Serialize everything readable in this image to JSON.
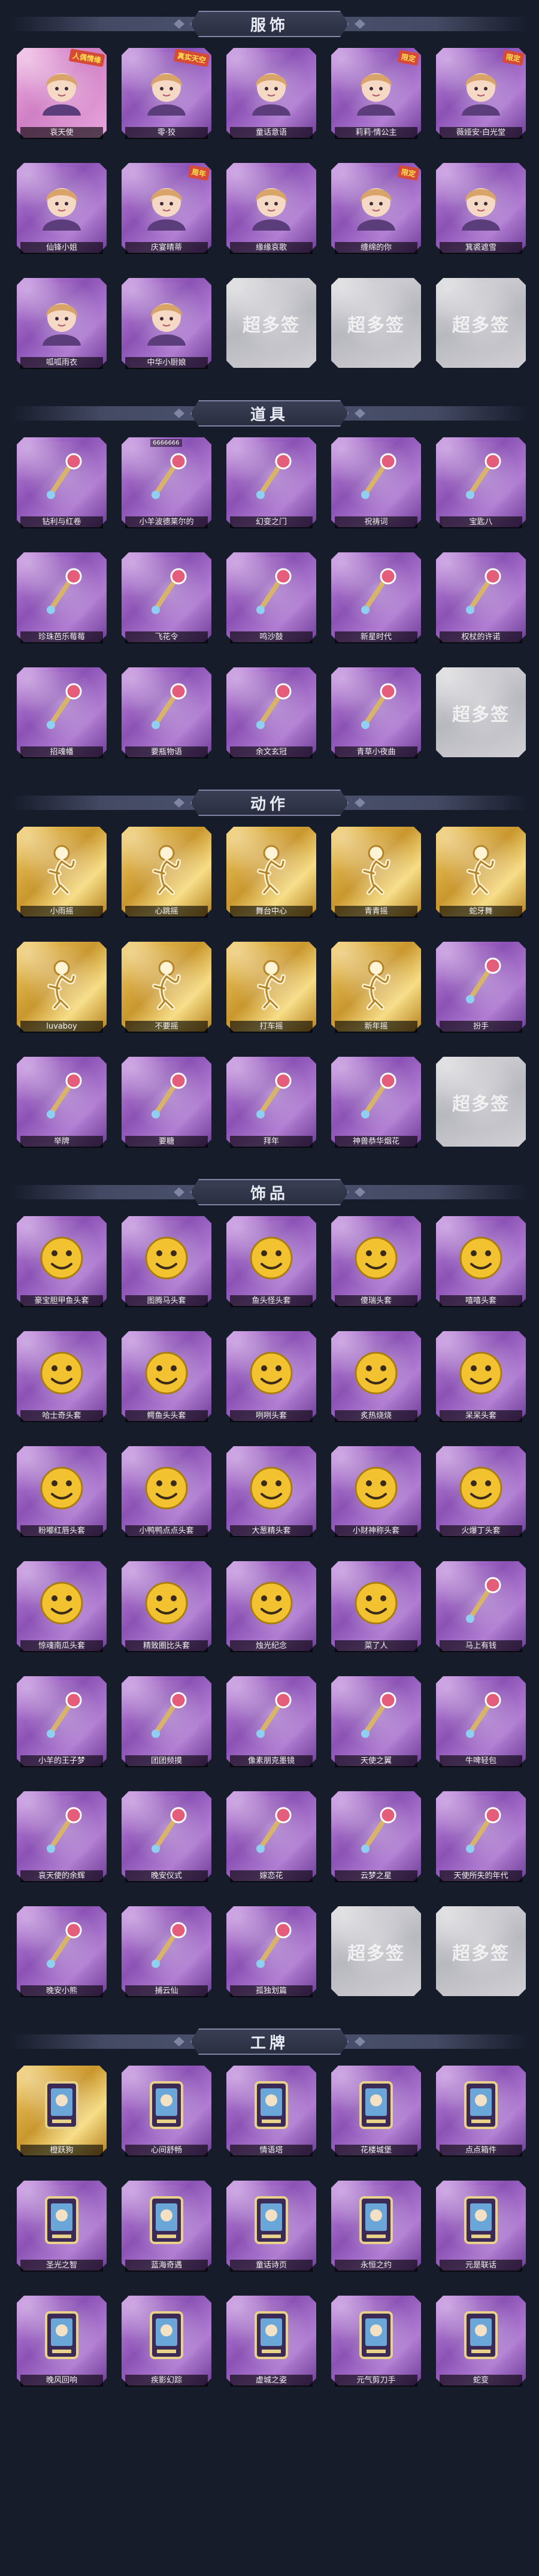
{
  "sections": [
    {
      "title": "服饰",
      "items": [
        {
          "label": "哀天使",
          "style": "pink",
          "icon": "angel-costume-icon",
          "tag": "人偶情缘"
        },
        {
          "label": "零·狡",
          "style": "purple",
          "icon": "white-hair-costume-icon",
          "tag": "真实天空"
        },
        {
          "label": "童话意语",
          "style": "purple",
          "icon": "bride-costume-icon",
          "tag": ""
        },
        {
          "label": "莉莉·情公主",
          "style": "purple",
          "icon": "pink-hair-costume-icon",
          "tag": "限定"
        },
        {
          "label": "薇娅安·白光堂",
          "style": "purple",
          "icon": "brown-hair-costume-icon",
          "tag": "限定"
        },
        {
          "label": "仙锋小姐",
          "style": "purple",
          "icon": "curly-hair-costume-icon",
          "tag": ""
        },
        {
          "label": "庆宴晴蒂",
          "style": "purple",
          "icon": "party-costume-icon",
          "tag": "周年"
        },
        {
          "label": "缘缘哀歌",
          "style": "purple",
          "icon": "gothic-costume-icon",
          "tag": ""
        },
        {
          "label": "缠绵的你",
          "style": "purple",
          "icon": "hat-costume-icon",
          "tag": "限定"
        },
        {
          "label": "箕裘遮雪",
          "style": "purple",
          "icon": "winter-costume-icon",
          "tag": ""
        },
        {
          "label": "呱呱雨衣",
          "style": "purple",
          "icon": "frog-raincoat-costume-icon",
          "tag": ""
        },
        {
          "label": "中华小厨娘",
          "style": "purple",
          "icon": "chef-costume-icon",
          "tag": ""
        },
        {
          "label": "",
          "style": "empty",
          "icon": "empty-slot-icon",
          "tag": ""
        },
        {
          "label": "",
          "style": "empty",
          "icon": "empty-slot-icon",
          "tag": ""
        },
        {
          "label": "",
          "style": "empty",
          "icon": "empty-slot-icon",
          "tag": ""
        }
      ]
    },
    {
      "title": "道具",
      "items": [
        {
          "label": "钻利与红卷",
          "style": "purple",
          "icon": "red-wand-icon",
          "tag": ""
        },
        {
          "label": "小羊波德莱尔的",
          "style": "purple",
          "icon": "golden-sword-icon",
          "tag": "",
          "id_tag": "6666666"
        },
        {
          "label": "幻变之门",
          "style": "purple",
          "icon": "pager-icon",
          "tag": ""
        },
        {
          "label": "祝祷词",
          "style": "purple",
          "icon": "scepter-icon",
          "tag": ""
        },
        {
          "label": "宝匙八",
          "style": "purple",
          "icon": "heart-frame-icon",
          "tag": ""
        },
        {
          "label": "珍珠芭乐莓莓",
          "style": "purple",
          "icon": "bubble-tea-icon",
          "tag": ""
        },
        {
          "label": "飞花令",
          "style": "purple",
          "icon": "flower-bouquet-icon",
          "tag": ""
        },
        {
          "label": "鸣沙鼓",
          "style": "purple",
          "icon": "drum-icon",
          "tag": ""
        },
        {
          "label": "新星时代",
          "style": "purple",
          "icon": "revolver-icon",
          "tag": ""
        },
        {
          "label": "权杖的许诺",
          "style": "purple",
          "icon": "crystal-staff-icon",
          "tag": ""
        },
        {
          "label": "招魂幡",
          "style": "purple",
          "icon": "banner-icon",
          "tag": ""
        },
        {
          "label": "要瓶物语",
          "style": "purple",
          "icon": "medkit-icon",
          "tag": ""
        },
        {
          "label": "余文玄冠",
          "style": "purple",
          "icon": "lantern-icon",
          "tag": ""
        },
        {
          "label": "青草小夜曲",
          "style": "purple",
          "icon": "frog-icon",
          "tag": ""
        },
        {
          "label": "",
          "style": "empty",
          "icon": "empty-slot-icon",
          "tag": ""
        }
      ]
    },
    {
      "title": "动作",
      "items": [
        {
          "label": "小雨摇",
          "style": "gold",
          "icon": "action-pose-icon",
          "tag": ""
        },
        {
          "label": "心跳摇",
          "style": "gold",
          "icon": "action-pose-icon",
          "tag": ""
        },
        {
          "label": "舞台中心",
          "style": "gold",
          "icon": "action-pose-icon",
          "tag": ""
        },
        {
          "label": "青青摇",
          "style": "gold",
          "icon": "action-pose-icon",
          "tag": ""
        },
        {
          "label": "蛇牙舞",
          "style": "gold",
          "icon": "action-pose-icon",
          "tag": ""
        },
        {
          "label": "luvaboy",
          "style": "gold",
          "icon": "action-pose-icon",
          "tag": ""
        },
        {
          "label": "不要摇",
          "style": "gold",
          "icon": "action-pose-icon",
          "tag": ""
        },
        {
          "label": "打车摇",
          "style": "gold",
          "icon": "action-pose-icon",
          "tag": ""
        },
        {
          "label": "新年摇",
          "style": "gold",
          "icon": "action-pose-icon",
          "tag": ""
        },
        {
          "label": "扮手",
          "style": "purple",
          "icon": "dragon-gesture-icon",
          "tag": ""
        },
        {
          "label": "举牌",
          "style": "purple",
          "icon": "sign-holding-icon",
          "tag": ""
        },
        {
          "label": "要糖",
          "style": "purple",
          "icon": "candy-gesture-icon",
          "tag": ""
        },
        {
          "label": "拜年",
          "style": "purple",
          "icon": "bow-gesture-icon",
          "tag": ""
        },
        {
          "label": "神兽恭华烟花",
          "style": "purple",
          "icon": "fireworks-icon",
          "tag": ""
        },
        {
          "label": "",
          "style": "empty",
          "icon": "empty-slot-icon",
          "tag": ""
        }
      ]
    },
    {
      "title": "饰品",
      "items": [
        {
          "label": "豪宝胆甲鱼头套",
          "style": "purple",
          "icon": "fish-head-icon",
          "tag": ""
        },
        {
          "label": "图腾马头套",
          "style": "purple",
          "icon": "horse-head-icon",
          "tag": ""
        },
        {
          "label": "鱼头怪头套",
          "style": "purple",
          "icon": "fishman-head-icon",
          "tag": ""
        },
        {
          "label": "傻瑞头套",
          "style": "purple",
          "icon": "smiley-head-icon",
          "tag": ""
        },
        {
          "label": "嘻嘻头套",
          "style": "purple",
          "icon": "grin-head-icon",
          "tag": ""
        },
        {
          "label": "哈士奇头套",
          "style": "purple",
          "icon": "husky-head-icon",
          "tag": ""
        },
        {
          "label": "鳄鱼头头套",
          "style": "purple",
          "icon": "crocodile-head-icon",
          "tag": ""
        },
        {
          "label": "咧咧头套",
          "style": "purple",
          "icon": "laugh-head-icon",
          "tag": ""
        },
        {
          "label": "炙热烧烧",
          "style": "purple",
          "icon": "toast-head-icon",
          "tag": ""
        },
        {
          "label": "呆呆头套",
          "style": "purple",
          "icon": "stare-head-icon",
          "tag": ""
        },
        {
          "label": "粉嘟红唇头套",
          "style": "purple",
          "icon": "yellow-bird-head-icon",
          "tag": ""
        },
        {
          "label": "小鸭鸭点点头套",
          "style": "purple",
          "icon": "duck-head-icon",
          "tag": ""
        },
        {
          "label": "大葱精头套",
          "style": "purple",
          "icon": "scallion-head-icon",
          "tag": ""
        },
        {
          "label": "小财神称头套",
          "style": "purple",
          "icon": "lucky-head-icon",
          "tag": ""
        },
        {
          "label": "火爆丁头套",
          "style": "purple",
          "icon": "fire-head-icon",
          "tag": ""
        },
        {
          "label": "惊魂南瓜头套",
          "style": "purple",
          "icon": "pumpkin-head-icon",
          "tag": ""
        },
        {
          "label": "精致圈比头套",
          "style": "purple",
          "icon": "pink-blob-head-icon",
          "tag": ""
        },
        {
          "label": "烛光纪念",
          "style": "purple",
          "icon": "candle-head-icon",
          "tag": ""
        },
        {
          "label": "菜了人",
          "style": "purple",
          "icon": "radish-head-icon",
          "tag": ""
        },
        {
          "label": "马上有钱",
          "style": "purple",
          "icon": "horse-toy-icon",
          "tag": ""
        },
        {
          "label": "小羊的王子梦",
          "style": "purple",
          "icon": "lamb-prince-icon",
          "tag": ""
        },
        {
          "label": "团团频摸",
          "style": "purple",
          "icon": "cat-plush-icon",
          "tag": ""
        },
        {
          "label": "像素朋克墨镜",
          "style": "purple",
          "icon": "pixel-sunglasses-icon",
          "tag": ""
        },
        {
          "label": "天使之翼",
          "style": "purple",
          "icon": "angel-wings-icon",
          "tag": ""
        },
        {
          "label": "牛啤轻包",
          "style": "purple",
          "icon": "cow-bag-icon",
          "tag": ""
        },
        {
          "label": "哀天使的余辉",
          "style": "purple",
          "icon": "angel-doll-icon",
          "tag": ""
        },
        {
          "label": "晚安仪式",
          "style": "purple",
          "icon": "pig-doll-icon",
          "tag": ""
        },
        {
          "label": "嫁恋花",
          "style": "purple",
          "icon": "flower-wreath-icon",
          "tag": ""
        },
        {
          "label": "云梦之星",
          "style": "purple",
          "icon": "dream-unicorn-icon",
          "tag": ""
        },
        {
          "label": "天使所失的年代",
          "style": "purple",
          "icon": "angel-frame-icon",
          "tag": ""
        },
        {
          "label": "晚安小熊",
          "style": "purple",
          "icon": "bear-charm-icon",
          "tag": ""
        },
        {
          "label": "捕云仙",
          "style": "purple",
          "icon": "cloud-charm-icon",
          "tag": ""
        },
        {
          "label": "孤独划篇",
          "style": "purple",
          "icon": "sakura-branch-icon",
          "tag": ""
        },
        {
          "label": "",
          "style": "empty",
          "icon": "empty-slot-icon",
          "tag": ""
        },
        {
          "label": "",
          "style": "empty",
          "icon": "empty-slot-icon",
          "tag": ""
        }
      ]
    },
    {
      "title": "工牌",
      "items": [
        {
          "label": "橙跃狗",
          "style": "gold",
          "icon": "card-badge-icon",
          "tag": ""
        },
        {
          "label": "心间舒畅",
          "style": "purple",
          "icon": "card-badge-icon",
          "tag": ""
        },
        {
          "label": "情语塔",
          "style": "purple",
          "icon": "card-badge-icon",
          "tag": ""
        },
        {
          "label": "花楼城堡",
          "style": "purple",
          "icon": "card-badge-icon",
          "tag": ""
        },
        {
          "label": "点点箱件",
          "style": "purple",
          "icon": "card-badge-icon",
          "tag": ""
        },
        {
          "label": "圣光之智",
          "style": "purple",
          "icon": "card-badge-icon",
          "tag": ""
        },
        {
          "label": "蓝海奇遇",
          "style": "purple",
          "icon": "card-badge-icon",
          "tag": ""
        },
        {
          "label": "童话诗页",
          "style": "purple",
          "icon": "card-badge-icon",
          "tag": ""
        },
        {
          "label": "永恒之约",
          "style": "purple",
          "icon": "card-badge-icon",
          "tag": ""
        },
        {
          "label": "元是联话",
          "style": "purple",
          "icon": "card-badge-icon",
          "tag": ""
        },
        {
          "label": "晚风回响",
          "style": "purple",
          "icon": "card-badge-icon",
          "tag": ""
        },
        {
          "label": "疾影幻踪",
          "style": "purple",
          "icon": "card-badge-icon",
          "tag": ""
        },
        {
          "label": "虚城之姿",
          "style": "purple",
          "icon": "card-badge-icon",
          "tag": ""
        },
        {
          "label": "元气剪刀手",
          "style": "purple",
          "icon": "card-badge-icon",
          "tag": ""
        },
        {
          "label": "蛇变",
          "style": "purple",
          "icon": "card-badge-icon",
          "tag": ""
        }
      ]
    }
  ],
  "empty_slot_watermark": "超多签",
  "colors": {
    "background": "#171c2b",
    "header_band": "#444a63",
    "card_purple": "#8b52b5",
    "card_gold": "#c9972e",
    "card_empty": "#b8b8bf",
    "label_bg": "#000000"
  }
}
